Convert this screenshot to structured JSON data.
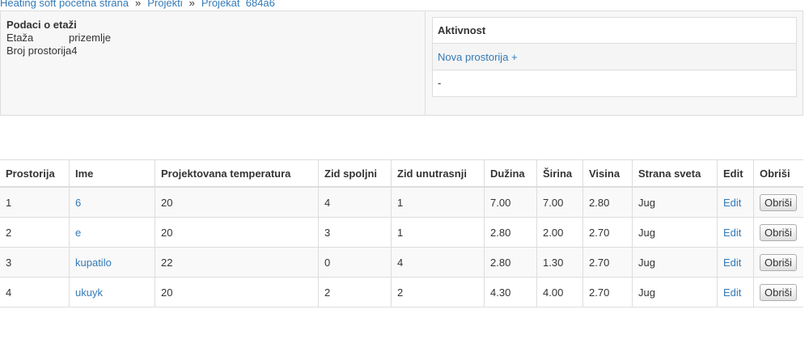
{
  "breadcrumb": {
    "home": "Heating soft pocetna strana",
    "sep": "»",
    "projects": "Projekti",
    "project": "Projekat  684a6"
  },
  "floor": {
    "title": "Podaci o etaži",
    "floor_label": "Etaža",
    "floor_value": "prizemlje",
    "rooms_label": "Broj prostorija",
    "rooms_value": "4"
  },
  "activity": {
    "title": "Aktivnost",
    "new_room": "Nova prostorija +",
    "placeholder": "-"
  },
  "table": {
    "headers": [
      "Prostorija",
      "Ime",
      "Projektovana temperatura",
      "Zid spoljni",
      "Zid unutrasnji",
      "Dužina",
      "Širina",
      "Visina",
      "Strana sveta",
      "Edit",
      "Obriši"
    ],
    "rows": [
      {
        "num": "1",
        "name": "6",
        "temp": "20",
        "outer": "4",
        "inner": "1",
        "length": "7.00",
        "width": "7.00",
        "height": "2.80",
        "side": "Jug",
        "edit": "Edit",
        "delete": "Obriši"
      },
      {
        "num": "2",
        "name": "e",
        "temp": "20",
        "outer": "3",
        "inner": "1",
        "length": "2.80",
        "width": "2.00",
        "height": "2.70",
        "side": "Jug",
        "edit": "Edit",
        "delete": "Obriši"
      },
      {
        "num": "3",
        "name": "kupatilo",
        "temp": "22",
        "outer": "0",
        "inner": "4",
        "length": "2.80",
        "width": "1.30",
        "height": "2.70",
        "side": "Jug",
        "edit": "Edit",
        "delete": "Obriši"
      },
      {
        "num": "4",
        "name": "ukuyk",
        "temp": "20",
        "outer": "2",
        "inner": "2",
        "length": "4.30",
        "width": "4.00",
        "height": "2.70",
        "side": "Jug",
        "edit": "Edit",
        "delete": "Obriši"
      }
    ]
  }
}
